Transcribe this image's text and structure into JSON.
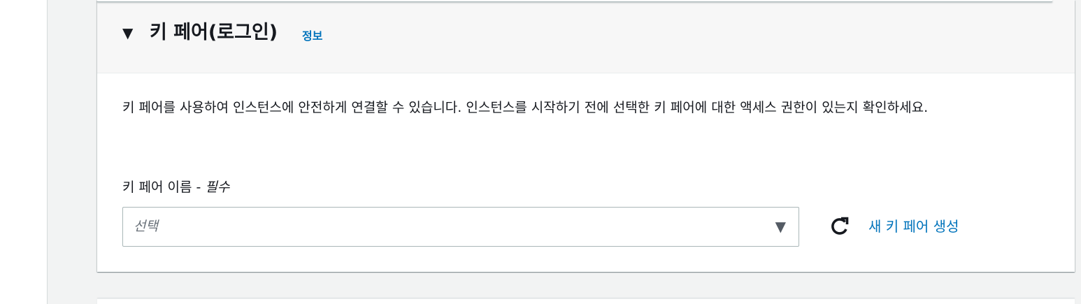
{
  "section": {
    "caret_glyph": "▼",
    "title": "키 페어(로그인)",
    "info_link": "정보",
    "description": "키 페어를 사용하여 인스턴스에 안전하게 연결할 수 있습니다. 인스턴스를 시작하기 전에 선택한 키 페어에 대한 액세스 권한이 있는지 확인하세요."
  },
  "key_pair_field": {
    "label": "키 페어 이름 - ",
    "required": "필수",
    "placeholder": "선택",
    "caret_glyph": "▼"
  },
  "actions": {
    "refresh_icon": "refresh-icon",
    "create_link": "새 키 페어 생성"
  },
  "colors": {
    "link": "#0073bb",
    "header_bg": "#f7f7f7",
    "page_bg": "#f2f3f3",
    "text": "#16191f",
    "border": "#aab7b8"
  }
}
